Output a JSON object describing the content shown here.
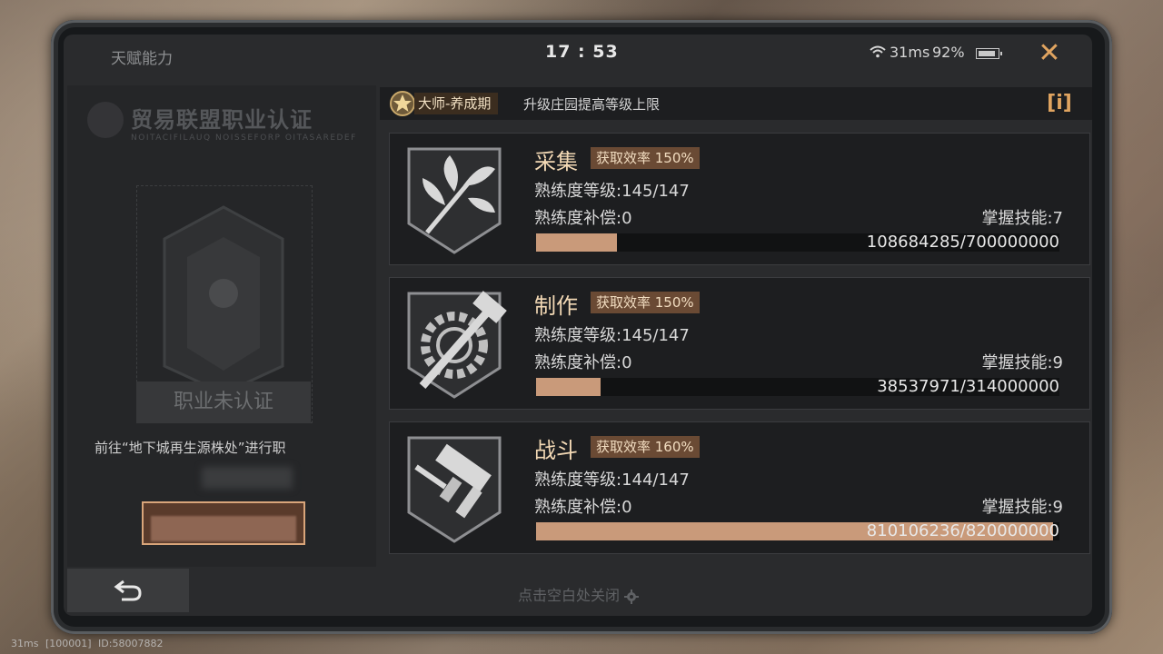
{
  "topbar": {
    "title": "天赋能力",
    "clock": "17 : 53",
    "ping": "31ms",
    "battery": "92%",
    "close_icon": "close-icon"
  },
  "left_panel": {
    "cert_title": "贸易联盟职业认证",
    "cert_subtitle": "NOITACIFILAUQ NOISSEFORP OITASAREDEF",
    "uncertified_label": "职业未认证",
    "hint_text": "前往“地下城再生源株处”进行职"
  },
  "rank_bar": {
    "rank_label": "大师-养成期",
    "description": "升级庄园提高等级上限",
    "info_icon": "info-icon"
  },
  "skills": [
    {
      "name": "采集",
      "efficiency": "获取效率 150%",
      "level": "熟练度等级:145/147",
      "compensation": "熟练度补偿:0",
      "skills_mastered": "掌握技能:7",
      "xp_text": "108684285/700000000",
      "xp_fraction": 0.155,
      "icon": "herb-icon"
    },
    {
      "name": "制作",
      "efficiency": "获取效率 150%",
      "level": "熟练度等级:145/147",
      "compensation": "熟练度补偿:0",
      "skills_mastered": "掌握技能:9",
      "xp_text": "38537971/314000000",
      "xp_fraction": 0.123,
      "icon": "hammer-gear-icon"
    },
    {
      "name": "战斗",
      "efficiency": "获取效率 160%",
      "level": "熟练度等级:144/147",
      "compensation": "熟练度补偿:0",
      "skills_mastered": "掌握技能:9",
      "xp_text": "810106236/820000000",
      "xp_fraction": 0.988,
      "icon": "gun-icon"
    }
  ],
  "bottom": {
    "close_hint": "点击空白处关闭"
  },
  "footer": {
    "ping": "31ms",
    "server": "[100001]",
    "id": "ID:58007882"
  },
  "colors": {
    "accent": "#e0a460",
    "xp_fill": "#c99a7a",
    "badge": "#6a4a34"
  }
}
